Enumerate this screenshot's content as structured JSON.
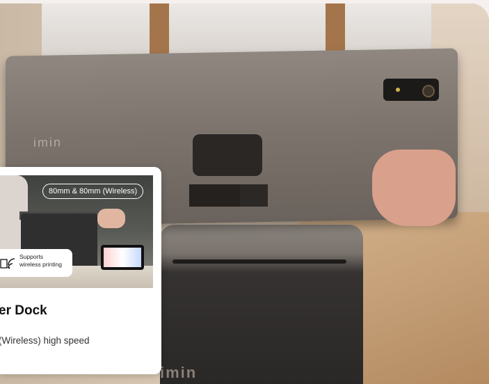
{
  "hero": {
    "device_logo": "imin",
    "stand_logo": "imin"
  },
  "card": {
    "badge": "80mm & 80mm (Wireless)",
    "support_line1": "Supports",
    "support_line2": "wireless printing",
    "title": "er Dock",
    "description": "(Wireless) high speed"
  },
  "icons": {
    "wireless": "wireless-print-icon"
  }
}
